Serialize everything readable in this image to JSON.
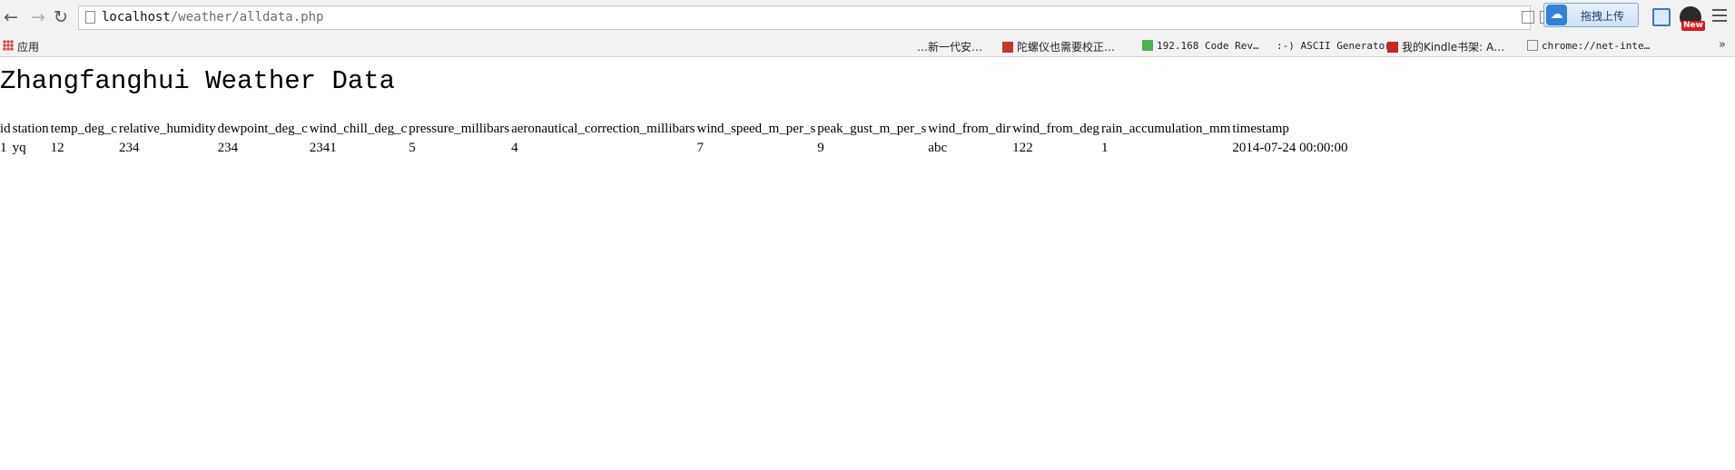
{
  "browser": {
    "url_host": "localhost",
    "url_path": "/weather/alldata.php",
    "upload_label": "拖拽上传",
    "new_badge": "New",
    "icons": [
      "back-icon",
      "forward-icon",
      "reload-icon",
      "page-icon",
      "upload-icon",
      "screen-capture-icon",
      "extension-icon",
      "menu-icon"
    ]
  },
  "bookmarks": {
    "apps_label": "应用",
    "items": [
      {
        "label": "…新一代安…"
      },
      {
        "label": "陀螺仪也需要校正…"
      },
      {
        "label": "192.168 Code Rev…"
      },
      {
        "label": ":-) ASCII Generator"
      },
      {
        "label": "我的Kindle书架: A…"
      },
      {
        "label": "chrome://net-inte…"
      }
    ],
    "overflow_label": "»"
  },
  "page": {
    "title": "Zhangfanghui Weather Data",
    "table": {
      "headers": [
        "id",
        "station",
        "temp_deg_c",
        "relative_humidity",
        "dewpoint_deg_c",
        "wind_chill_deg_c",
        "pressure_millibars",
        "aeronautical_correction_millibars",
        "wind_speed_m_per_s",
        "peak_gust_m_per_s",
        "wind_from_dir",
        "wind_from_deg",
        "rain_accumulation_mm",
        "timestamp"
      ],
      "rows": [
        [
          "1",
          "yq",
          "12",
          "234",
          "234",
          "2341",
          "5",
          "4",
          "7",
          "9",
          "abc",
          "122",
          "1",
          "2014-07-24 00:00:00"
        ]
      ]
    }
  }
}
